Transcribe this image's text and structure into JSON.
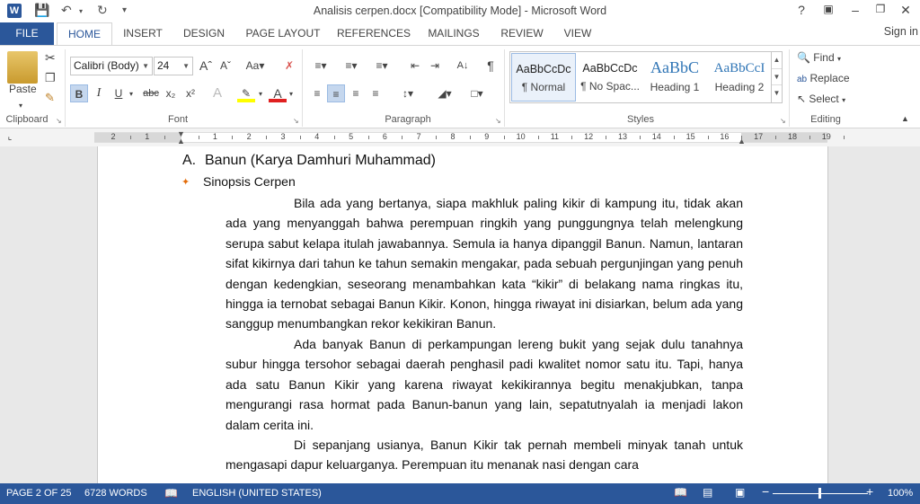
{
  "titlebar": {
    "title": "Analisis cerpen.docx [Compatibility Mode] - Microsoft Word",
    "app_icon": "W",
    "help": "?"
  },
  "tabs": {
    "file": "FILE",
    "items": [
      "HOME",
      "INSERT",
      "DESIGN",
      "PAGE LAYOUT",
      "REFERENCES",
      "MAILINGS",
      "REVIEW",
      "VIEW"
    ],
    "signin": "Sign in"
  },
  "ribbon": {
    "clipboard": {
      "label": "Clipboard",
      "paste": "Paste"
    },
    "font": {
      "label": "Font",
      "font_name": "Calibri (Body)",
      "font_size": "24"
    },
    "paragraph": {
      "label": "Paragraph"
    },
    "styles": {
      "label": "Styles",
      "items": [
        {
          "sample": "AaBbCcDc",
          "name": "¶ Normal"
        },
        {
          "sample": "AaBbCcDc",
          "name": "¶ No Spac..."
        },
        {
          "sample": "AaBbC",
          "name": "Heading 1"
        },
        {
          "sample": "AaBbCcI",
          "name": "Heading 2"
        }
      ]
    },
    "editing": {
      "label": "Editing",
      "find": "Find",
      "replace": "Replace",
      "select": "Select"
    }
  },
  "ruler": {
    "numbers": [
      "2",
      "1",
      "",
      "1",
      "2",
      "3",
      "4",
      "5",
      "6",
      "7",
      "8",
      "9",
      "10",
      "11",
      "12",
      "13",
      "14",
      "15",
      "16",
      "17",
      "18",
      "19"
    ]
  },
  "document": {
    "heading_num": "A.",
    "heading": "Banun (Karya Damhuri Muhammad)",
    "bullet": "Sinopsis Cerpen",
    "paragraphs": [
      "Bila ada yang bertanya, siapa makhluk paling kikir di kampung itu, tidak akan ada yang menyanggah bahwa perempuan ringkih yang punggungnya telah melengkung serupa sabut kelapa itulah jawabannya. Semula ia hanya dipanggil Banun. Namun, lantaran sifat kikirnya dari tahun ke tahun semakin mengakar, pada sebuah pergunjingan yang penuh dengan kedengkian, seseorang menambahkan kata “kikir” di belakang nama ringkas itu, hingga ia ternobat sebagai Banun Kikir. Konon, hingga riwayat ini disiarkan, belum ada yang sanggup menumbangkan rekor kekikiran Banun.",
      "Ada banyak Banun di perkampungan lereng bukit yang sejak dulu tanahnya subur hingga tersohor sebagai daerah penghasil padi kwalitet nomor satu itu. Tapi, hanya ada satu Banun Kikir yang karena riwayat kekikirannya begitu menakjubkan, tanpa mengurangi rasa hormat pada Banun-banun yang lain, sepatutnyalah ia menjadi lakon dalam cerita ini.",
      "Di sepanjang usianya, Banun Kikir tak pernah membeli minyak tanah untuk mengasapi dapur keluarganya. Perempuan itu menanak nasi dengan cara"
    ]
  },
  "status": {
    "page": "PAGE 2 OF 25",
    "words": "6728 WORDS",
    "language": "ENGLISH (UNITED STATES)",
    "zoom": "100%",
    "zoom_percent": 100
  },
  "colors": {
    "word_blue": "#2b579a",
    "heading_blue": "#2e74b5",
    "spell_red": "#d33"
  }
}
